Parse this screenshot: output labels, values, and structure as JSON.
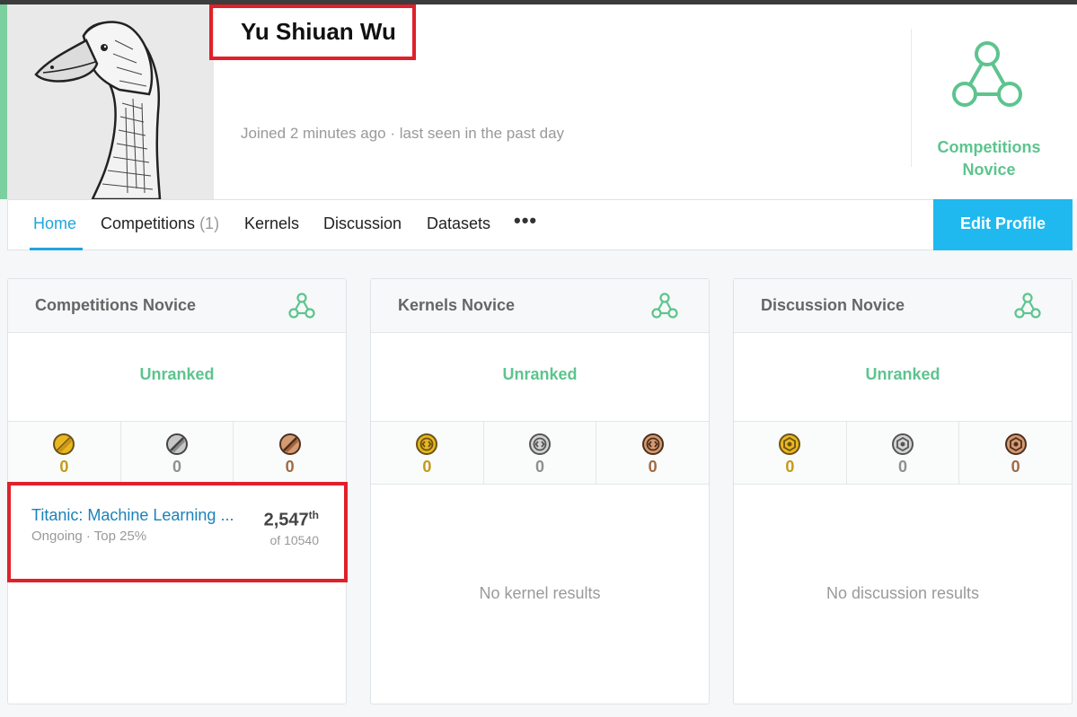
{
  "profile": {
    "name": "Yu Shiuan Wu",
    "joined": "Joined 2 minutes ago · last seen in the past day",
    "tier_line1": "Competitions",
    "tier_line2": "Novice",
    "tier_icon": "novice-tier-icon"
  },
  "nav": {
    "home": "Home",
    "competitions": "Competitions",
    "competitions_count": "(1)",
    "kernels": "Kernels",
    "discussion": "Discussion",
    "datasets": "Datasets",
    "more": "•••",
    "edit_profile": "Edit Profile"
  },
  "cards": [
    {
      "title": "Competitions Novice",
      "rank": "Unranked",
      "medal_icon": "competition-medal-icon",
      "gold": "0",
      "silver": "0",
      "bronze": "0",
      "results": [
        {
          "title": "Titanic: Machine Learning ...",
          "status": "Ongoing · Top 25%",
          "rank": "2,547",
          "rank_suffix": "th",
          "of": "of 10540"
        }
      ]
    },
    {
      "title": "Kernels Novice",
      "rank": "Unranked",
      "medal_icon": "kernel-medal-icon",
      "gold": "0",
      "silver": "0",
      "bronze": "0",
      "empty": "No kernel results"
    },
    {
      "title": "Discussion Novice",
      "rank": "Unranked",
      "medal_icon": "discussion-medal-icon",
      "gold": "0",
      "silver": "0",
      "bronze": "0",
      "empty": "No discussion results"
    }
  ],
  "colors": {
    "accent_green": "#5dc48e",
    "accent_blue": "#1fb9ef",
    "highlight_red": "#e0202a",
    "gold": "#c39a1a",
    "silver": "#8f8f8f",
    "bronze": "#a06a45"
  }
}
